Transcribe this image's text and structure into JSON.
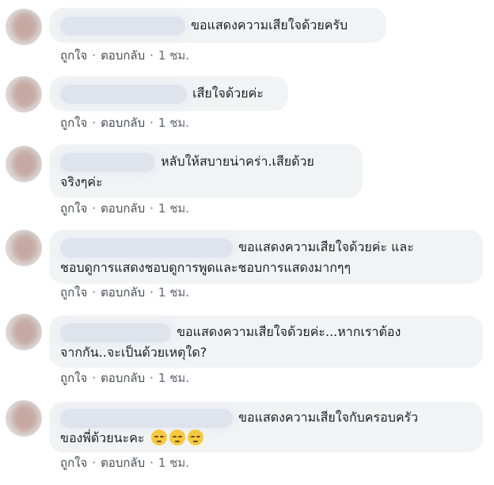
{
  "comments": [
    {
      "name_tail": "",
      "text": "ขอแสดงความเสียใจด้วยครับ",
      "actions": {
        "like": "ถูกใจ",
        "reply": "ตอบกลับ",
        "time": "1 ชม."
      }
    },
    {
      "name_tail": "",
      "text": "เสียใจด้วยค่ะ",
      "actions": {
        "like": "ถูกใจ",
        "reply": "ตอบกลับ",
        "time": "1 ชม."
      }
    },
    {
      "name_tail": "",
      "text": "หลับให้สบายน่าคร่า.เสียด้วย",
      "text2": "จริงๆค่ะ",
      "actions": {
        "like": "ถูกใจ",
        "reply": "ตอบกลับ",
        "time": "1 ชม."
      }
    },
    {
      "name_tail": "",
      "text": "ขอแสดงความเสียใจด้วยค่ะ และ",
      "text2": "ชอบดูการแสดงชอบดูการพูดและชอบการแสดงมากๆๆ",
      "actions": {
        "like": "ถูกใจ",
        "reply": "ตอบกลับ",
        "time": "1 ชม."
      }
    },
    {
      "name_tail": "",
      "text": "ขอแสดงความเสียใจด้วยค่ะ...หากเราต้อง",
      "text2": "จากกัน..จะเป็นด้วยเหตุใด?",
      "actions": {
        "like": "ถูกใจ",
        "reply": "ตอบกลับ",
        "time": "1 ชม."
      }
    },
    {
      "name_tail": "",
      "text": "ขอแสดงความเสียใจกับครอบครัว",
      "text2": "ของพี่ด้วยนะคะ",
      "emoji": "pensive-face-emoji",
      "actions": {
        "like": "ถูกใจ",
        "reply": "ตอบกลับ",
        "time": "1 ชม."
      }
    }
  ]
}
